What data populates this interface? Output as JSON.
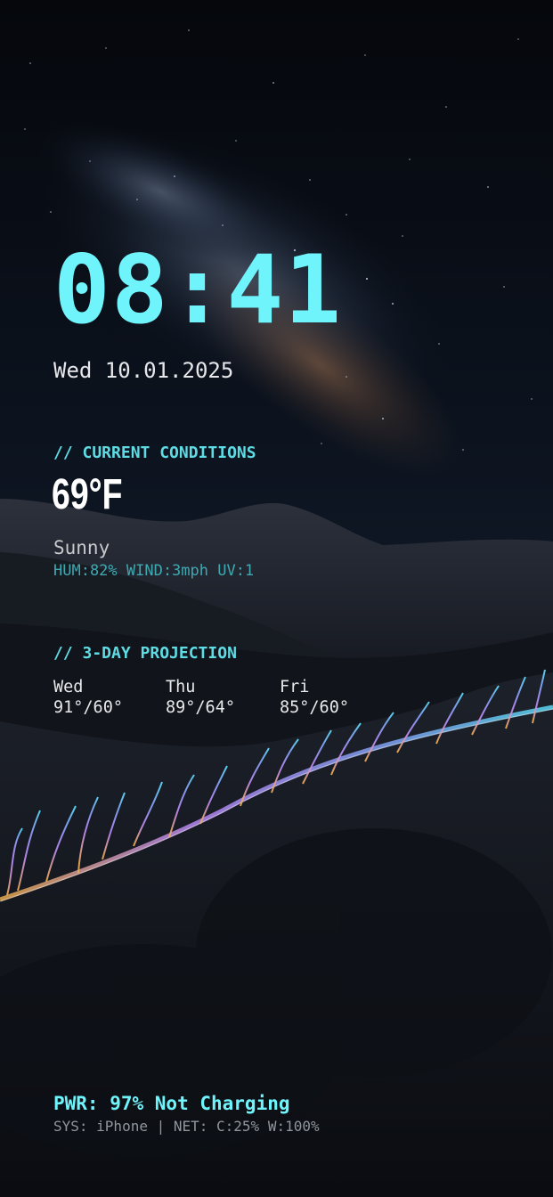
{
  "clock": {
    "time": "08:41",
    "date": "Wed 10.01.2025"
  },
  "current": {
    "title": "// CURRENT CONDITIONS",
    "temperature": "69°F",
    "condition": "Sunny",
    "stats": "HUM:82% WIND:3mph UV:1"
  },
  "forecast": {
    "title": "// 3-DAY PROJECTION",
    "days": [
      {
        "day": "Wed",
        "range": "91°/60°"
      },
      {
        "day": "Thu",
        "range": "89°/64°"
      },
      {
        "day": "Fri",
        "range": "85°/60°"
      }
    ]
  },
  "footer": {
    "power": "PWR: 97% Not Charging",
    "system": "SYS: iPhone | NET: C:25% W:100%"
  },
  "colors": {
    "accent": "#6ff4fb",
    "accent_dim": "#3fa9b2",
    "text": "#e6e7ea",
    "background": "#05070b"
  },
  "background": {
    "icon": "night-desert-milky-way-wallpaper"
  }
}
